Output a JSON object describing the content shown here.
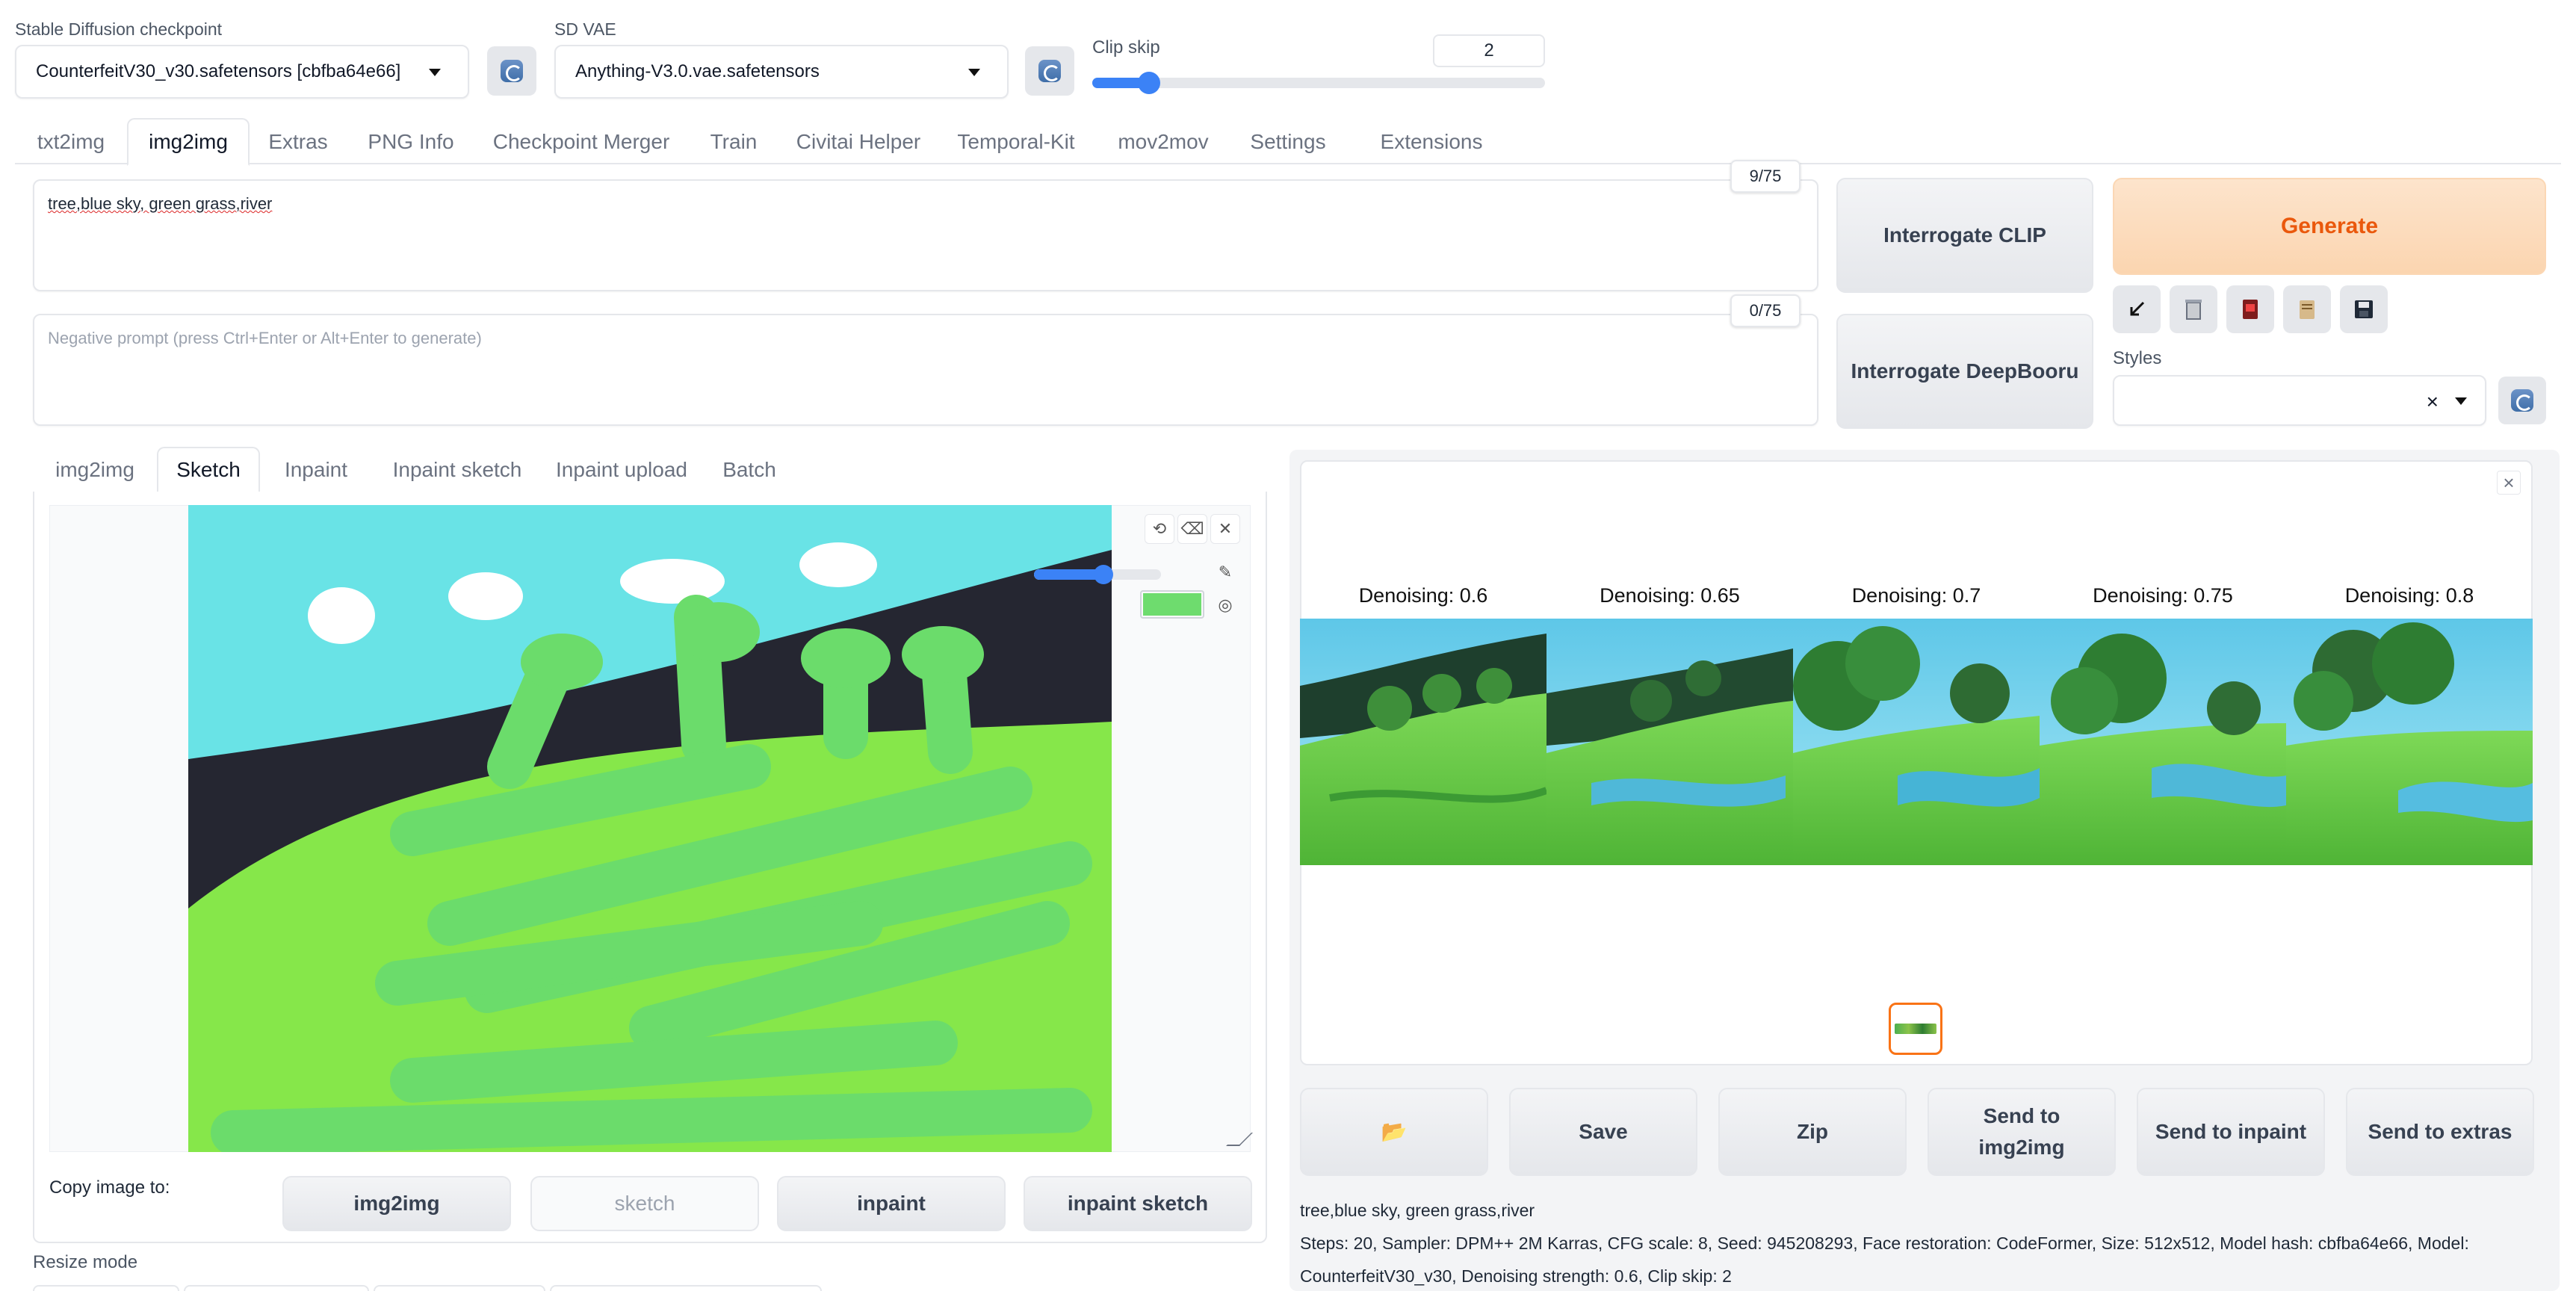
{
  "top": {
    "checkpoint_label": "Stable Diffusion checkpoint",
    "checkpoint_value": "CounterfeitV30_v30.safetensors [cbfba64e66]",
    "vae_label": "SD VAE",
    "vae_value": "Anything-V3.0.vae.safetensors",
    "clip_skip_label": "Clip skip",
    "clip_skip_value": "2",
    "clip_skip_fraction": 0.1
  },
  "tabs": [
    "txt2img",
    "img2img",
    "Extras",
    "PNG Info",
    "Checkpoint Merger",
    "Train",
    "Civitai Helper",
    "Temporal-Kit",
    "mov2mov",
    "Settings",
    "Extensions"
  ],
  "active_tab": "img2img",
  "prompt": {
    "value": "tree,blue sky, green grass,river",
    "counter": "9/75",
    "negative_placeholder": "Negative prompt (press Ctrl+Enter or Alt+Enter to generate)",
    "negative_counter": "0/75"
  },
  "actions": {
    "interrogate_clip": "Interrogate CLIP",
    "interrogate_deepbooru": "Interrogate DeepBooru",
    "generate": "Generate",
    "styles_label": "Styles",
    "styles_clear": "×"
  },
  "tool_icons": [
    "arrow-icon",
    "trash-icon",
    "card-icon",
    "clipboard-icon",
    "save-icon"
  ],
  "subtabs": [
    "img2img",
    "Sketch",
    "Inpaint",
    "Inpaint sketch",
    "Inpaint upload",
    "Batch"
  ],
  "active_subtab": "Sketch",
  "sketch": {
    "brush_color": "#6edc6e",
    "copy_label": "Copy image to:",
    "copy_buttons": [
      "img2img",
      "sketch",
      "inpaint",
      "inpaint sketch"
    ]
  },
  "resize_mode_label": "Resize mode",
  "gallery": {
    "labels": [
      "Denoising: 0.6",
      "Denoising: 0.65",
      "Denoising: 0.7",
      "Denoising: 0.75",
      "Denoising: 0.8"
    ],
    "close": "×"
  },
  "output_buttons": {
    "folder": "📂",
    "save": "Save",
    "zip": "Zip",
    "send_img2img": "Send to img2img",
    "send_inpaint": "Send to inpaint",
    "send_extras": "Send to extras"
  },
  "info": {
    "prompt": "tree,blue sky, green grass,river",
    "params": "Steps: 20, Sampler: DPM++ 2M Karras, CFG scale: 8, Seed: 945208293, Face restoration: CodeFormer, Size: 512x512, Model hash: cbfba64e66, Model: CounterfeitV30_v30, Denoising strength: 0.6, Clip skip: 2"
  }
}
